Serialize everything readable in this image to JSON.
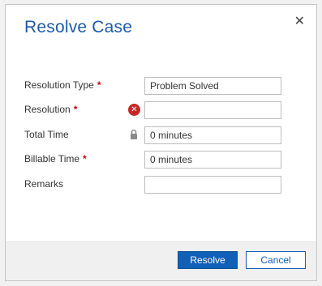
{
  "dialog": {
    "title": "Resolve Case",
    "close_glyph": "✕",
    "close_icon": "close-icon"
  },
  "form": {
    "resolution_type": {
      "label": "Resolution Type",
      "required": "*",
      "value": "Problem Solved"
    },
    "resolution": {
      "label": "Resolution",
      "required": "*",
      "value": "",
      "status_icon": "error-icon",
      "status_glyph": "✕"
    },
    "total_time": {
      "label": "Total Time",
      "value": "0 minutes",
      "status_icon": "lock-icon"
    },
    "billable_time": {
      "label": "Billable Time",
      "required": "*",
      "value": "0 minutes"
    },
    "remarks": {
      "label": "Remarks",
      "value": ""
    }
  },
  "footer": {
    "resolve_label": "Resolve",
    "cancel_label": "Cancel"
  },
  "colors": {
    "title": "#1f5aa6",
    "required": "#cc0000",
    "error": "#c62828",
    "primary_button": "#1160b7"
  }
}
